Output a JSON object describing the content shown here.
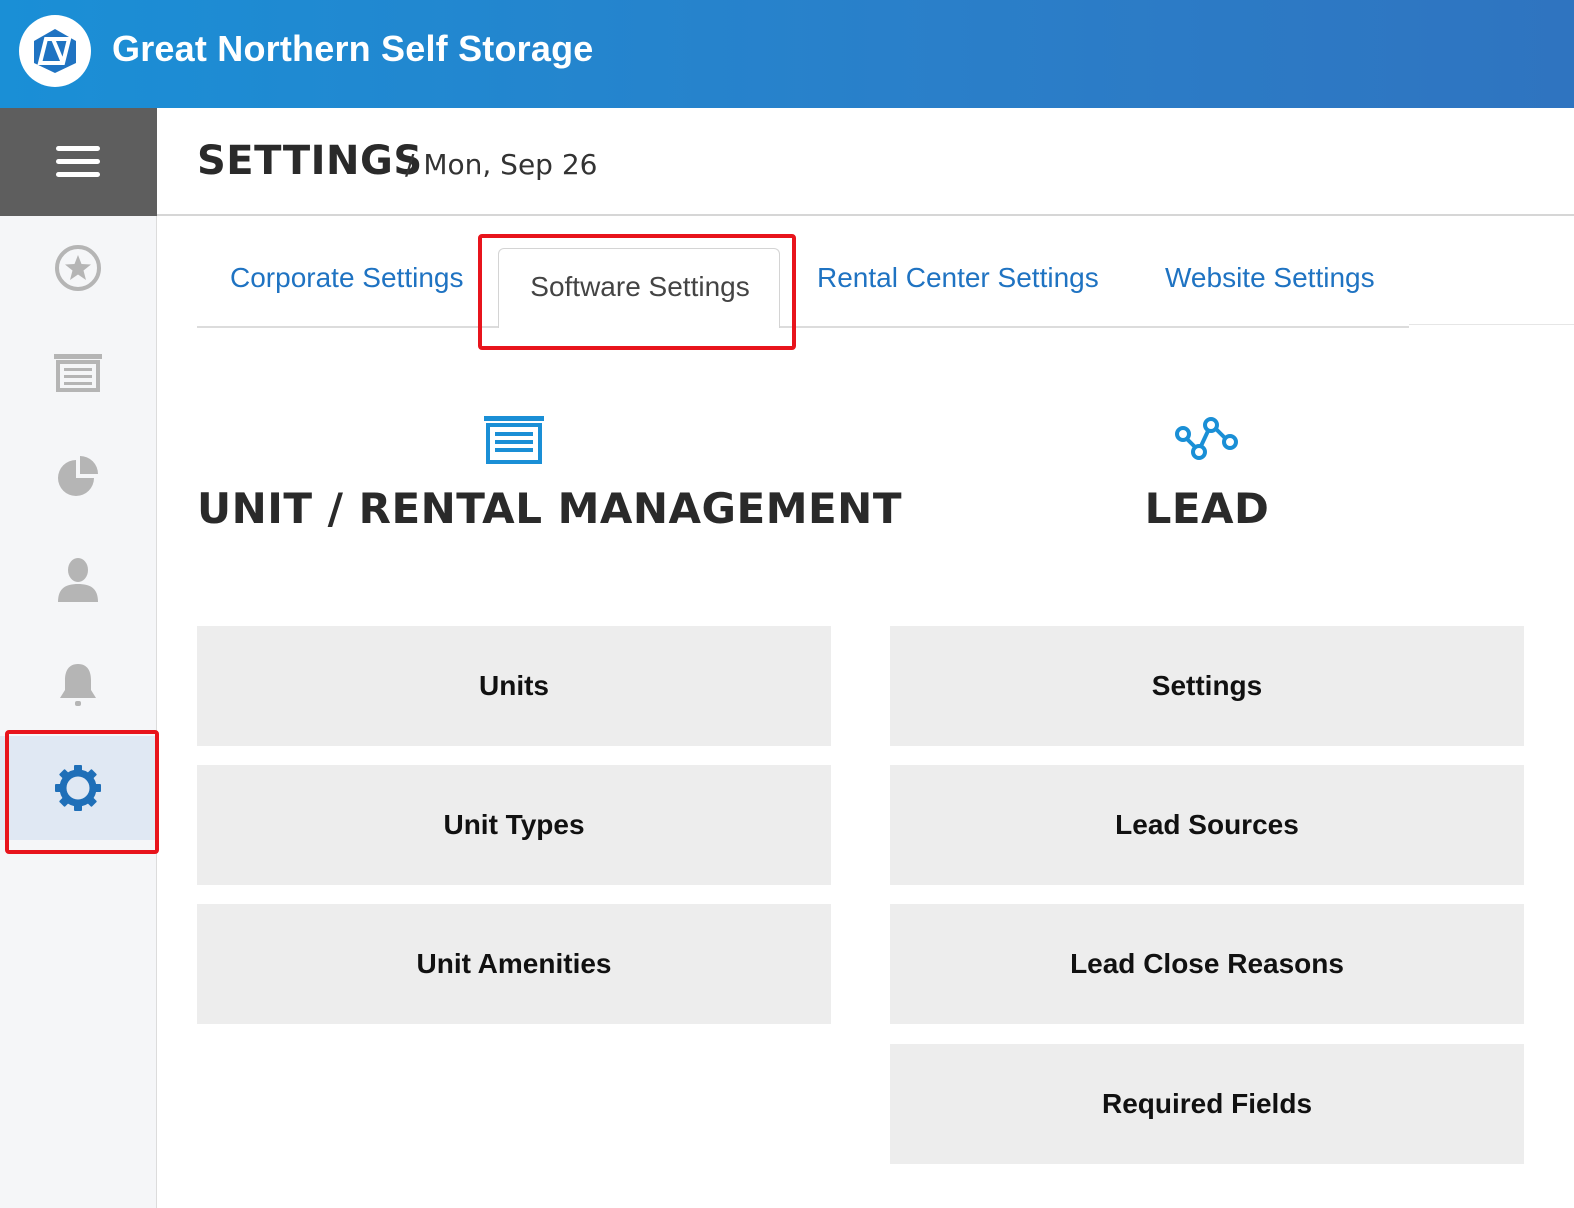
{
  "header": {
    "title": "Great Northern Self Storage"
  },
  "page": {
    "title": "SETTINGS",
    "date": "/ Mon, Sep 26"
  },
  "tabs": [
    {
      "label": "Corporate Settings"
    },
    {
      "label": "Software Settings"
    },
    {
      "label": "Rental Center Settings"
    },
    {
      "label": "Website Settings"
    }
  ],
  "active_tab": "Software Settings",
  "sidebar": {
    "items": [
      {
        "icon": "star-icon"
      },
      {
        "icon": "storage-unit-icon"
      },
      {
        "icon": "pie-chart-icon"
      },
      {
        "icon": "user-icon"
      },
      {
        "icon": "bell-icon"
      },
      {
        "icon": "gear-icon",
        "active": true
      }
    ]
  },
  "sections": {
    "unit": {
      "title": "UNIT / RENTAL MANAGEMENT",
      "icon": "storage-unit-icon",
      "items": [
        "Units",
        "Unit Types",
        "Unit Amenities"
      ]
    },
    "lead": {
      "title": "LEAD",
      "icon": "lead-flow-icon",
      "items": [
        "Settings",
        "Lead Sources",
        "Lead Close Reasons",
        "Required Fields"
      ]
    }
  },
  "colors": {
    "header_blue": "#1a8fd6",
    "link_blue": "#1f73c2",
    "highlight_red": "#e8141c",
    "card_gray": "#ededed"
  }
}
